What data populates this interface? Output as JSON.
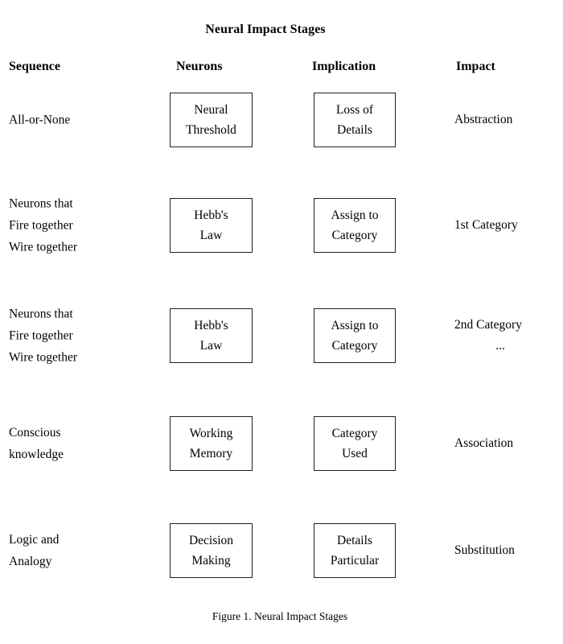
{
  "figure": {
    "title": "Neural Impact Stages",
    "caption": "Figure 1. Neural Impact Stages"
  },
  "columns": [
    {
      "key": "sequence",
      "label": "Sequence"
    },
    {
      "key": "neurons",
      "label": "Neurons"
    },
    {
      "key": "implication",
      "label": "Implication"
    },
    {
      "key": "impact",
      "label": "Impact"
    }
  ],
  "rows": [
    {
      "sequence": "All-or-None",
      "neurons": "Neural\nThreshold",
      "implication": "Loss of\nDetails",
      "impact": "Abstraction",
      "impact_note": ""
    },
    {
      "sequence": "Neurons that\nFire together\nWire together",
      "neurons": "Hebb's\nLaw",
      "implication": "Assign to\nCategory",
      "impact": "1st Category",
      "impact_note": ""
    },
    {
      "sequence": "Neurons that\nFire together\nWire together",
      "neurons": "Hebb's\nLaw",
      "implication": "Assign to\nCategory",
      "impact": "2nd Category",
      "impact_note": "..."
    },
    {
      "sequence": "Conscious\nknowledge",
      "neurons": "Working\nMemory",
      "implication": "Category\nUsed",
      "impact": "Association",
      "impact_note": ""
    },
    {
      "sequence": "Logic and\nAnalogy",
      "neurons": "Decision\nMaking",
      "implication": "Details\nParticular",
      "impact": "Substitution",
      "impact_note": ""
    }
  ],
  "style": {
    "box_border_color": "#231f20",
    "text_color": "#000000",
    "background_color": "#ffffff"
  },
  "layout": {
    "row_tops": [
      115,
      246,
      383,
      517,
      650
    ]
  }
}
